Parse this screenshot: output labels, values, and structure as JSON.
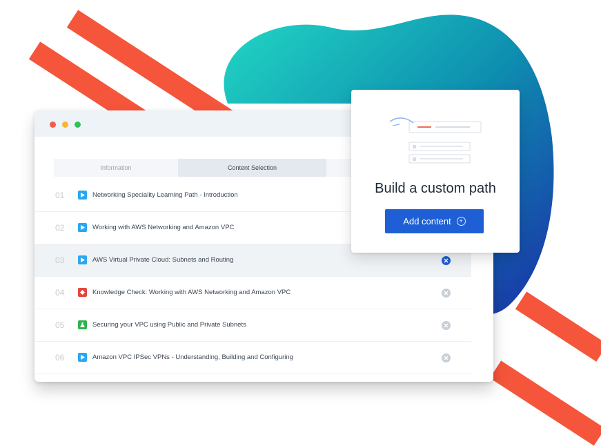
{
  "window": {
    "tabs": [
      {
        "label": "Information",
        "active": false
      },
      {
        "label": "Content Selection",
        "active": true
      }
    ]
  },
  "rows": [
    {
      "number": "01",
      "title": "Networking Speciality Learning Path - Introduction",
      "icon": "play-icon",
      "icon_color": "#29a8f0",
      "removable": false,
      "highlight": false
    },
    {
      "number": "02",
      "title": "Working with AWS Networking and Amazon VPC",
      "icon": "play-icon",
      "icon_color": "#29a8f0",
      "removable": false,
      "highlight": false
    },
    {
      "number": "03",
      "title": "AWS Virtual Private Cloud: Subnets and Routing",
      "icon": "play-icon",
      "icon_color": "#29a8f0",
      "removable": true,
      "remove_active": true,
      "highlight": true
    },
    {
      "number": "04",
      "title": "Knowledge Check: Working with AWS Networking and Amazon VPC",
      "icon": "quiz-icon",
      "icon_color": "#e8453c",
      "removable": true,
      "remove_active": false,
      "highlight": false
    },
    {
      "number": "05",
      "title": "Securing your VPC using Public and Private Subnets",
      "icon": "lab-icon",
      "icon_color": "#2fb34a",
      "removable": true,
      "remove_active": false,
      "highlight": false
    },
    {
      "number": "06",
      "title": "Amazon VPC IPSec VPNs - Understanding, Building and Configuring",
      "icon": "play-icon",
      "icon_color": "#29a8f0",
      "removable": true,
      "remove_active": false,
      "highlight": false
    }
  ],
  "card": {
    "title": "Build a custom path",
    "button_label": "Add content"
  },
  "colors": {
    "accent": "#1f5fd6",
    "stripe": "#f5553a",
    "blob_start": "#22d8c4",
    "blob_end": "#1a3fb8"
  }
}
